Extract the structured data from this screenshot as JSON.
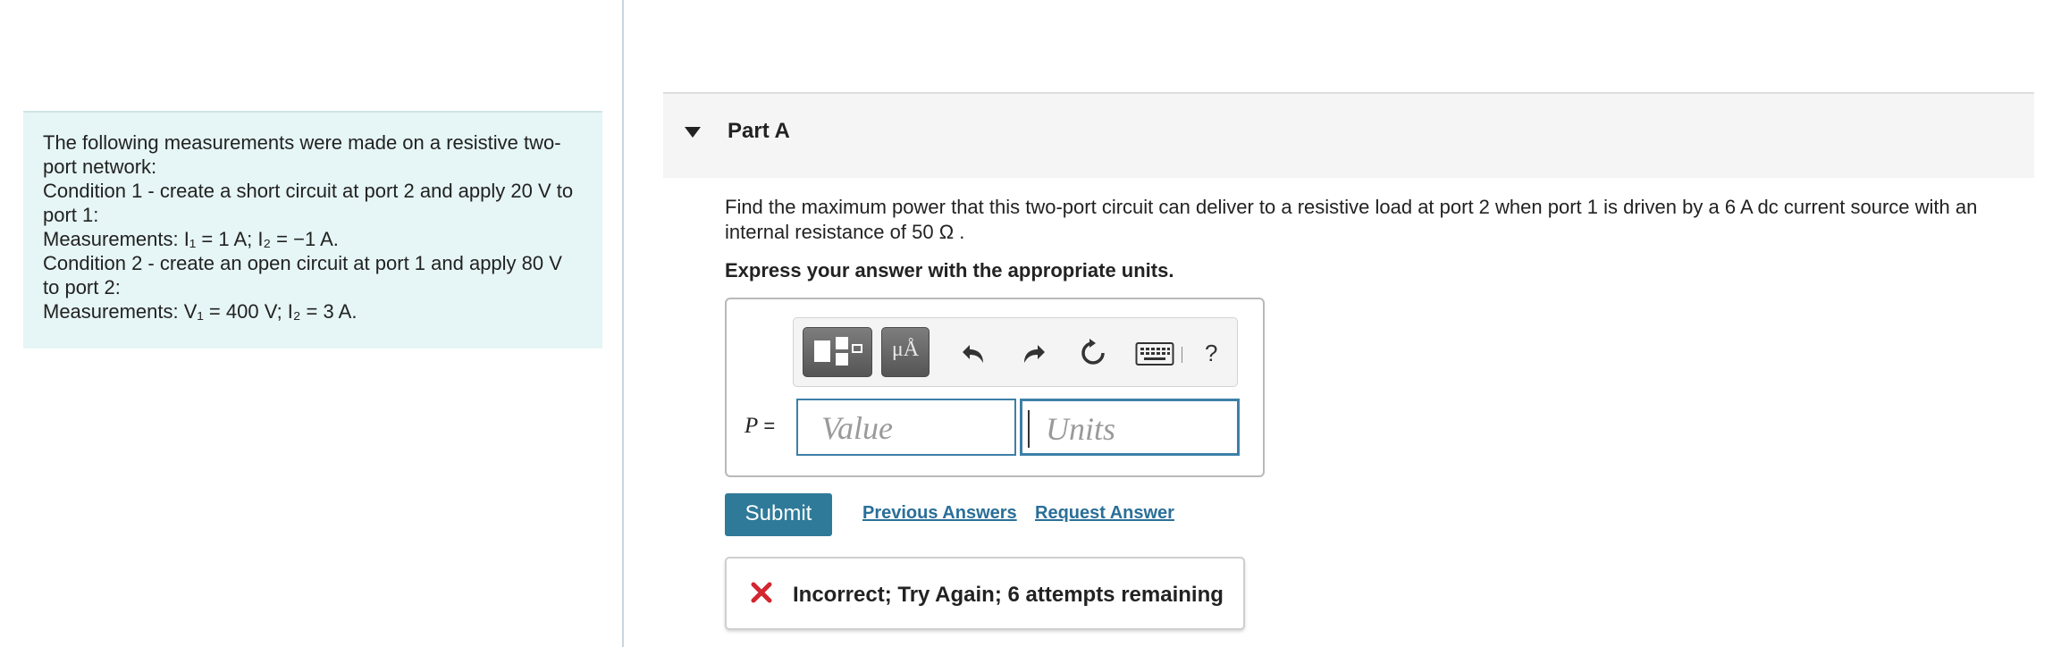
{
  "problem": {
    "lines": [
      "The following measurements were made on a resistive two-",
      "port network:",
      "Condition 1 - create a short circuit at port 2 and apply 20 V to",
      "port 1:",
      "Measurements: I₁ = 1 A; I₂ = −1 A.",
      "Condition 2 - create an open circuit at port 1 and apply 80 V",
      "to port 2:",
      "Measurements: V₁ = 400 V; I₂ = 3 A."
    ]
  },
  "part": {
    "title": "Part A",
    "question_line1": "Find the maximum power that this two-port circuit can deliver to a resistive load at port 2 when port 1 is driven by a 6 A dc current source with an",
    "question_line2": "internal resistance of 50 Ω .",
    "instruction": "Express your answer with the appropriate units."
  },
  "answer": {
    "toolbar": {
      "units_label": "μÅ",
      "help_label": "?",
      "icons": [
        "templates-icon",
        "units-icon",
        "undo-icon",
        "redo-icon",
        "reset-icon",
        "keyboard-icon",
        "help-icon"
      ]
    },
    "variable": "P",
    "equals": "=",
    "value_placeholder": "Value",
    "units_placeholder": "Units"
  },
  "actions": {
    "submit": "Submit",
    "previous_answers": "Previous Answers",
    "request_answer": "Request Answer"
  },
  "feedback": {
    "message": "Incorrect; Try Again; 6 attempts remaining",
    "icon": "x-icon",
    "color": "#d22630"
  },
  "colors": {
    "accent": "#2f7a99",
    "link": "#2a6f98",
    "problem_bg": "#e6f5f5"
  }
}
